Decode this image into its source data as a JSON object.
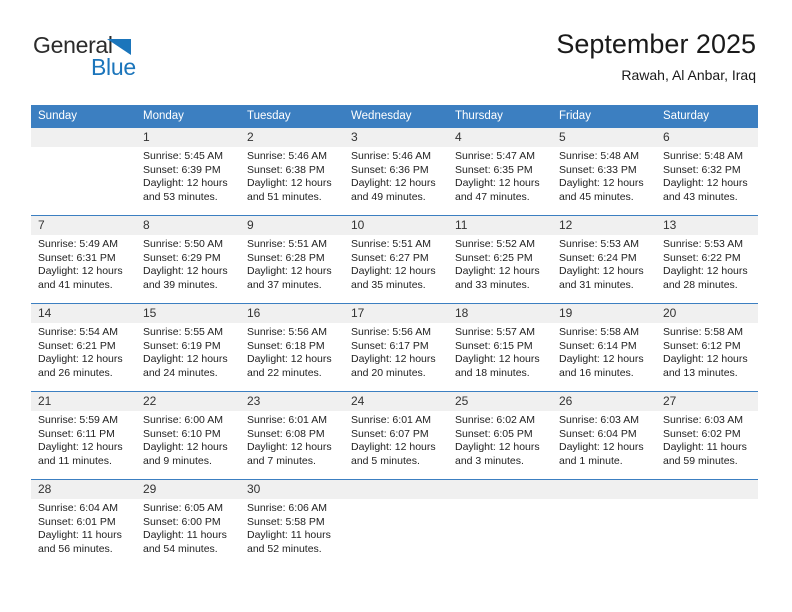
{
  "logo": {
    "word_top": "General",
    "word_bottom": "Blue",
    "accent_color": "#1b75bb",
    "triangle_icon": "triangle-icon"
  },
  "header": {
    "title": "September 2025",
    "subtitle": "Rawah, Al Anbar, Iraq"
  },
  "theme": {
    "header_bg": "#3c7fc1",
    "daynum_bg": "#f0f0f0",
    "text": "#222222"
  },
  "calendar": {
    "weekdays": [
      "Sunday",
      "Monday",
      "Tuesday",
      "Wednesday",
      "Thursday",
      "Friday",
      "Saturday"
    ],
    "weeks": [
      [
        {
          "day": "",
          "lines": []
        },
        {
          "day": "1",
          "lines": [
            "Sunrise: 5:45 AM",
            "Sunset: 6:39 PM",
            "Daylight: 12 hours",
            "and 53 minutes."
          ]
        },
        {
          "day": "2",
          "lines": [
            "Sunrise: 5:46 AM",
            "Sunset: 6:38 PM",
            "Daylight: 12 hours",
            "and 51 minutes."
          ]
        },
        {
          "day": "3",
          "lines": [
            "Sunrise: 5:46 AM",
            "Sunset: 6:36 PM",
            "Daylight: 12 hours",
            "and 49 minutes."
          ]
        },
        {
          "day": "4",
          "lines": [
            "Sunrise: 5:47 AM",
            "Sunset: 6:35 PM",
            "Daylight: 12 hours",
            "and 47 minutes."
          ]
        },
        {
          "day": "5",
          "lines": [
            "Sunrise: 5:48 AM",
            "Sunset: 6:33 PM",
            "Daylight: 12 hours",
            "and 45 minutes."
          ]
        },
        {
          "day": "6",
          "lines": [
            "Sunrise: 5:48 AM",
            "Sunset: 6:32 PM",
            "Daylight: 12 hours",
            "and 43 minutes."
          ]
        }
      ],
      [
        {
          "day": "7",
          "lines": [
            "Sunrise: 5:49 AM",
            "Sunset: 6:31 PM",
            "Daylight: 12 hours",
            "and 41 minutes."
          ]
        },
        {
          "day": "8",
          "lines": [
            "Sunrise: 5:50 AM",
            "Sunset: 6:29 PM",
            "Daylight: 12 hours",
            "and 39 minutes."
          ]
        },
        {
          "day": "9",
          "lines": [
            "Sunrise: 5:51 AM",
            "Sunset: 6:28 PM",
            "Daylight: 12 hours",
            "and 37 minutes."
          ]
        },
        {
          "day": "10",
          "lines": [
            "Sunrise: 5:51 AM",
            "Sunset: 6:27 PM",
            "Daylight: 12 hours",
            "and 35 minutes."
          ]
        },
        {
          "day": "11",
          "lines": [
            "Sunrise: 5:52 AM",
            "Sunset: 6:25 PM",
            "Daylight: 12 hours",
            "and 33 minutes."
          ]
        },
        {
          "day": "12",
          "lines": [
            "Sunrise: 5:53 AM",
            "Sunset: 6:24 PM",
            "Daylight: 12 hours",
            "and 31 minutes."
          ]
        },
        {
          "day": "13",
          "lines": [
            "Sunrise: 5:53 AM",
            "Sunset: 6:22 PM",
            "Daylight: 12 hours",
            "and 28 minutes."
          ]
        }
      ],
      [
        {
          "day": "14",
          "lines": [
            "Sunrise: 5:54 AM",
            "Sunset: 6:21 PM",
            "Daylight: 12 hours",
            "and 26 minutes."
          ]
        },
        {
          "day": "15",
          "lines": [
            "Sunrise: 5:55 AM",
            "Sunset: 6:19 PM",
            "Daylight: 12 hours",
            "and 24 minutes."
          ]
        },
        {
          "day": "16",
          "lines": [
            "Sunrise: 5:56 AM",
            "Sunset: 6:18 PM",
            "Daylight: 12 hours",
            "and 22 minutes."
          ]
        },
        {
          "day": "17",
          "lines": [
            "Sunrise: 5:56 AM",
            "Sunset: 6:17 PM",
            "Daylight: 12 hours",
            "and 20 minutes."
          ]
        },
        {
          "day": "18",
          "lines": [
            "Sunrise: 5:57 AM",
            "Sunset: 6:15 PM",
            "Daylight: 12 hours",
            "and 18 minutes."
          ]
        },
        {
          "day": "19",
          "lines": [
            "Sunrise: 5:58 AM",
            "Sunset: 6:14 PM",
            "Daylight: 12 hours",
            "and 16 minutes."
          ]
        },
        {
          "day": "20",
          "lines": [
            "Sunrise: 5:58 AM",
            "Sunset: 6:12 PM",
            "Daylight: 12 hours",
            "and 13 minutes."
          ]
        }
      ],
      [
        {
          "day": "21",
          "lines": [
            "Sunrise: 5:59 AM",
            "Sunset: 6:11 PM",
            "Daylight: 12 hours",
            "and 11 minutes."
          ]
        },
        {
          "day": "22",
          "lines": [
            "Sunrise: 6:00 AM",
            "Sunset: 6:10 PM",
            "Daylight: 12 hours",
            "and 9 minutes."
          ]
        },
        {
          "day": "23",
          "lines": [
            "Sunrise: 6:01 AM",
            "Sunset: 6:08 PM",
            "Daylight: 12 hours",
            "and 7 minutes."
          ]
        },
        {
          "day": "24",
          "lines": [
            "Sunrise: 6:01 AM",
            "Sunset: 6:07 PM",
            "Daylight: 12 hours",
            "and 5 minutes."
          ]
        },
        {
          "day": "25",
          "lines": [
            "Sunrise: 6:02 AM",
            "Sunset: 6:05 PM",
            "Daylight: 12 hours",
            "and 3 minutes."
          ]
        },
        {
          "day": "26",
          "lines": [
            "Sunrise: 6:03 AM",
            "Sunset: 6:04 PM",
            "Daylight: 12 hours",
            "and 1 minute."
          ]
        },
        {
          "day": "27",
          "lines": [
            "Sunrise: 6:03 AM",
            "Sunset: 6:02 PM",
            "Daylight: 11 hours",
            "and 59 minutes."
          ]
        }
      ],
      [
        {
          "day": "28",
          "lines": [
            "Sunrise: 6:04 AM",
            "Sunset: 6:01 PM",
            "Daylight: 11 hours",
            "and 56 minutes."
          ]
        },
        {
          "day": "29",
          "lines": [
            "Sunrise: 6:05 AM",
            "Sunset: 6:00 PM",
            "Daylight: 11 hours",
            "and 54 minutes."
          ]
        },
        {
          "day": "30",
          "lines": [
            "Sunrise: 6:06 AM",
            "Sunset: 5:58 PM",
            "Daylight: 11 hours",
            "and 52 minutes."
          ]
        },
        {
          "day": "",
          "lines": []
        },
        {
          "day": "",
          "lines": []
        },
        {
          "day": "",
          "lines": []
        },
        {
          "day": "",
          "lines": []
        }
      ]
    ]
  }
}
